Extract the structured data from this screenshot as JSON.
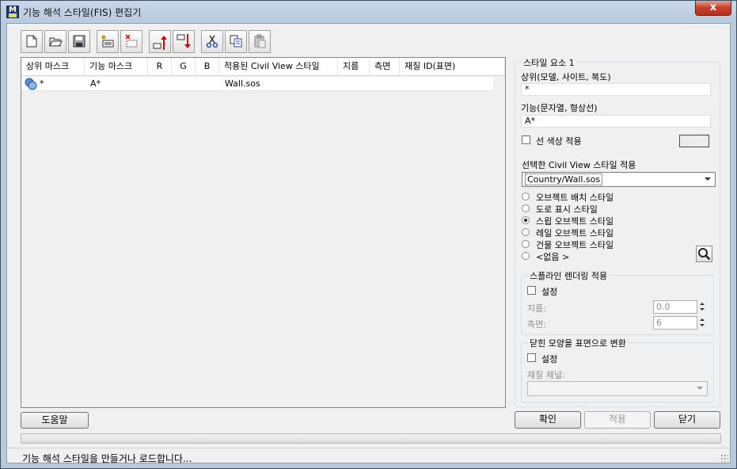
{
  "window": {
    "title": "기능 해석 스타일(FIS) 편집기",
    "app_icon_letter": "M",
    "close_symbol": "x"
  },
  "toolbar": {
    "buttons": [
      {
        "name": "new-icon"
      },
      {
        "name": "open-folder-icon"
      },
      {
        "name": "save-icon"
      },
      {
        "name": "add-rule-icon"
      },
      {
        "name": "delete-rule-icon"
      },
      {
        "name": "move-up-icon"
      },
      {
        "name": "move-down-icon"
      },
      {
        "name": "cut-icon"
      },
      {
        "name": "copy-icon"
      },
      {
        "name": "paste-icon"
      }
    ]
  },
  "grid": {
    "columns": [
      "상위 마스크",
      "기능 마스크",
      "R",
      "G",
      "B",
      "적용된 Civil View 스타일",
      "지름",
      "측면",
      "재질 ID(표면)"
    ],
    "rows": [
      {
        "parent_mask": "*",
        "feature_mask": "A*",
        "r": "",
        "g": "",
        "b": "",
        "style": "Wall.sos",
        "diameter": "",
        "sides": "",
        "material_id": ""
      }
    ]
  },
  "panel": {
    "group_title": "스타일 요소 1",
    "parent_label": "상위(모델, 사이트, 복도)",
    "parent_value": "*",
    "feature_label": "기능(문자열, 형상선)",
    "feature_value": "A*",
    "line_color_label": "선 색상 적용",
    "line_color_checked": false,
    "line_color_hex": "#ececec",
    "apply_style_label": "선택한 Civil View 스타일 적용",
    "style_value": "Country/Wall.sos",
    "style_options": [
      {
        "label": "오브젝트 배치 스타일",
        "selected": false
      },
      {
        "label": "도로 표시 스타일",
        "selected": false
      },
      {
        "label": "스윕 오브젝트 스타일",
        "selected": true
      },
      {
        "label": "레일 오브젝트 스타일",
        "selected": false
      },
      {
        "label": "건물 오브젝트 스타일",
        "selected": false
      },
      {
        "label": "<없음 >",
        "selected": false
      }
    ],
    "spline_group": {
      "title": "스플라인 렌더링 적용",
      "enable_label": "설정",
      "enabled": false,
      "diameter_label": "지름:",
      "diameter_value": "0.0",
      "sides_label": "측면:",
      "sides_value": "6"
    },
    "closed_group": {
      "title": "닫힌 모양을 표면으로 변환",
      "enable_label": "설정",
      "enabled": false,
      "material_label": "재질 채널:",
      "material_value": ""
    }
  },
  "buttons": {
    "help": "도움말",
    "ok": "확인",
    "apply": "적용",
    "close": "닫기"
  },
  "status": {
    "progress": 0,
    "text": "기능 해석 스타일을 만들거나 로드합니다..."
  }
}
